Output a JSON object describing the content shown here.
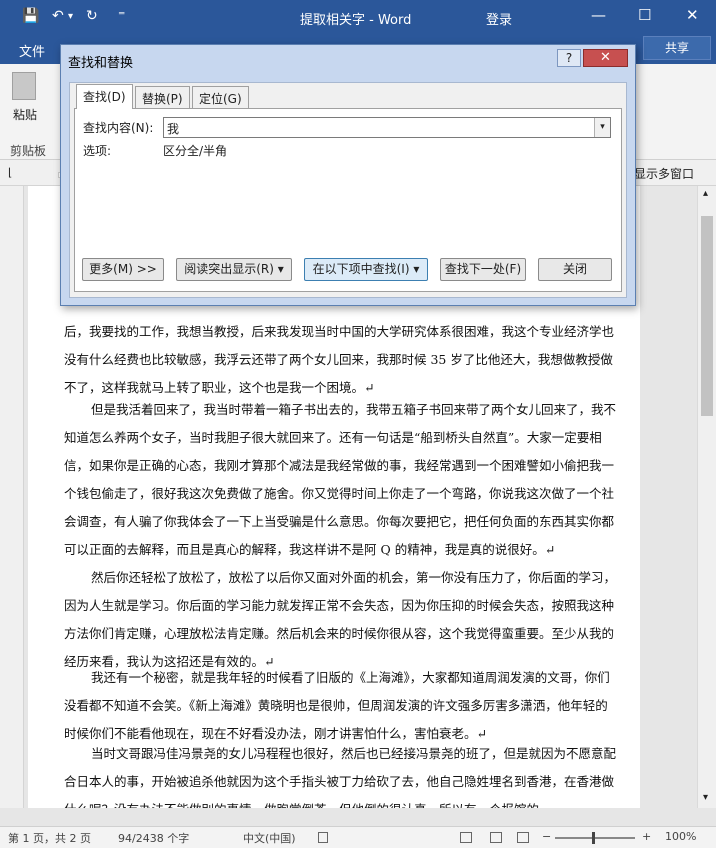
{
  "titlebar": {
    "title": "提取相关字 - Word",
    "login": "登录",
    "save_icon": "💾",
    "undo_icon": "↶",
    "undo_dd": "▾",
    "redo_icon": "↻",
    "customize_icon": "⁼",
    "min_icon": "—",
    "restore_icon": "☐",
    "close_icon": "✕"
  },
  "tabs": {
    "file": "文件",
    "share": "共享"
  },
  "ribbon": {
    "paste": "粘贴",
    "clipboard": "剪贴板",
    "multi_window": "显示多窗口",
    "scroll_up": "▴",
    "scroll_down": "▾"
  },
  "document": {
    "paragraphs": [
      "后，我要找的工作，我想当教授，后来我发现当时中国的大学研究体系很困难，我这个专业经济学也没有什么经费也比较敏感，我浮云还带了两个女儿回来，我那时候 35 岁了比他还大，我想做教授做不了，这样我就马上转了职业，这个也是我一个困境。↵",
      "但是我活着回来了，我当时带着一箱子书出去的，我带五箱子书回来带了两个女儿回来了，我不知道怎么养两个女子，当时我胆子很大就回来了。还有一句话是“船到桥头自然直”。大家一定要相信，如果你是正确的心态，我刚才算那个减法是我经常做的事，我经常遇到一个困难譬如小偷把我一个钱包偷走了，很好我这次免费做了施舍。你又觉得时间上你走了一个弯路，你说我这次做了一个社会调查，有人骗了你我体会了一下上当受骗是什么意思。你每次要把它，把任何负面的东西其实你都可以正面的去解释，而且是真心的解释，我这样讲不是阿 Q 的精神，我是真的说很好。↵",
      "然后你还轻松了放松了，放松了以后你又面对外面的机会，第一你没有压力了，你后面的学习，因为人生就是学习。你后面的学习能力就发挥正常不会失态，因为你压抑的时候会失态，按照我这种方法你们肯定赚，心理放松法肯定赚。然后机会来的时候你很从容，这个我觉得蛮重要。至少从我的经历来看，我认为这招还是有效的。↵",
      "我还有一个秘密，就是我年轻的时候看了旧版的《上海滩》，大家都知道周润发演的文哥，你们没看都不知道不会笑。《新上海滩》黄晓明也是很帅，但周润发演的许文强多厉害多潇洒，他年轻的时候你们不能看他现在，现在不好看没办法，刚才讲害怕什么，害怕衰老。↵",
      "当时文哥跟冯佳冯景尧的女儿冯程程也很好，然后也已经接冯景尧的班了，但是就因为不愿意配合日本人的事，开始被追杀他就因为这个手指头被丁力给砍了去，他自己隐姓埋名到香港，在香港做什么呢？没有办法不能做别的事情，做跑堂倒茶，但他倒的很认真，所以有一个报馆的"
    ]
  },
  "dialog": {
    "title": "查找和替换",
    "help": "?",
    "close": "✕",
    "tabs": [
      "查找(D)",
      "替换(P)",
      "定位(G)"
    ],
    "find_label": "查找内容(N):",
    "find_value": "我",
    "options_label": "选项:",
    "options_value": "区分全/半角",
    "combo_arrow": "▾",
    "buttons": {
      "more": "更多(M) >>",
      "reading_highlight": "阅读突出显示(R) ▾",
      "find_in": "在以下项中查找(I) ▾",
      "find_next": "查找下一处(F)",
      "close": "关闭"
    }
  },
  "status": {
    "page": "第 1 页，共 2 页",
    "words": "94/2438 个字",
    "language": "中文(中国)",
    "zoom_minus": "−",
    "zoom_plus": "+",
    "zoom": "100%",
    "zoom_level": 1.0
  }
}
